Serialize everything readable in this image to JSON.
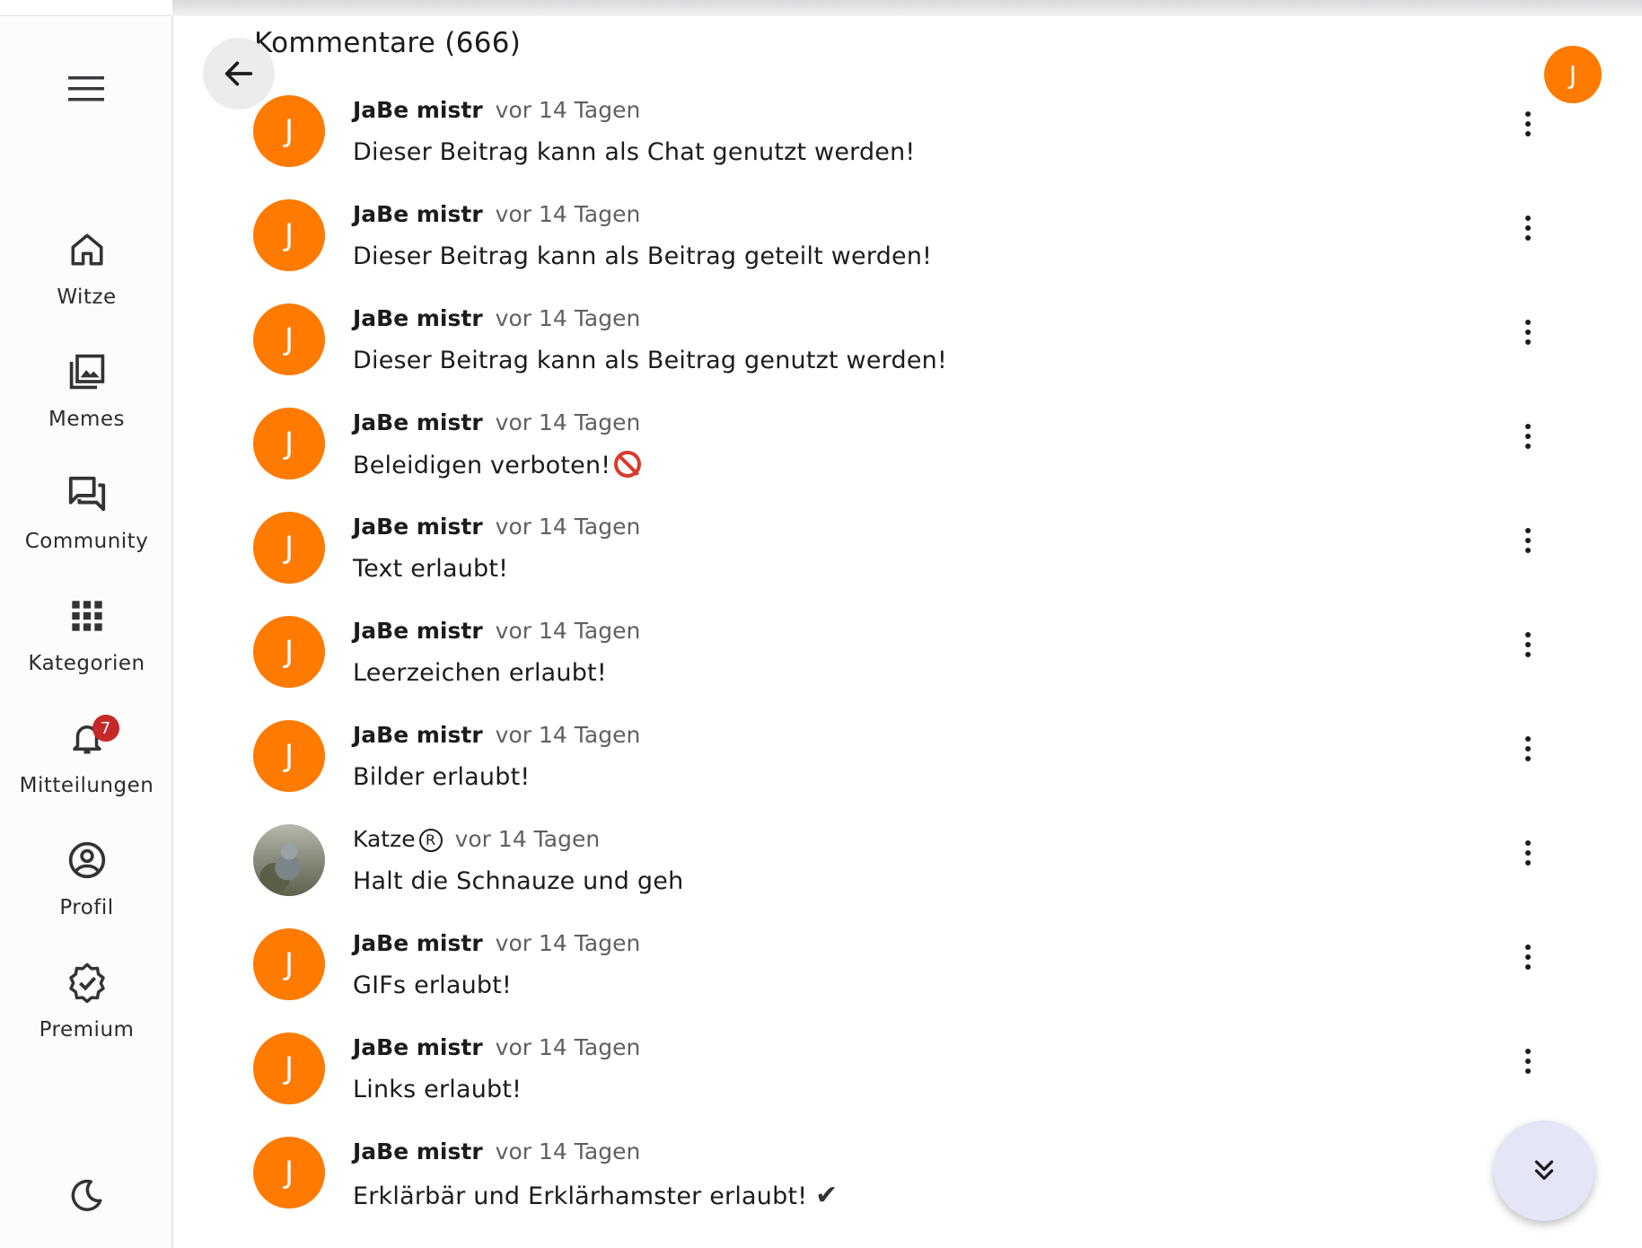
{
  "header": {
    "title": "Kommentare (666)",
    "user_initial": "J"
  },
  "sidebar": {
    "items": [
      {
        "label": "Witze",
        "icon": "home-icon"
      },
      {
        "label": "Memes",
        "icon": "photo-library-icon"
      },
      {
        "label": "Community",
        "icon": "forum-icon"
      },
      {
        "label": "Kategorien",
        "icon": "apps-grid-icon"
      },
      {
        "label": "Mitteilungen",
        "icon": "bell-icon",
        "badge": "7"
      },
      {
        "label": "Profil",
        "icon": "account-circle-icon"
      },
      {
        "label": "Premium",
        "icon": "verified-badge-icon"
      }
    ],
    "theme_toggle_icon": "moon-icon"
  },
  "comments": [
    {
      "author": "JaBe mistr",
      "initial": "J",
      "time": "vor 14 Tagen",
      "text": "Dieser Beitrag kann als Chat genutzt werden!"
    },
    {
      "author": "JaBe mistr",
      "initial": "J",
      "time": "vor 14 Tagen",
      "text": "Dieser Beitrag kann als Beitrag geteilt werden!"
    },
    {
      "author": "JaBe mistr",
      "initial": "J",
      "time": "vor 14 Tagen",
      "text": "Dieser Beitrag kann als Beitrag genutzt werden!"
    },
    {
      "author": "JaBe mistr",
      "initial": "J",
      "time": "vor 14 Tagen",
      "text": "Beleidigen verboten!"
    },
    {
      "author": "JaBe mistr",
      "initial": "J",
      "time": "vor 14 Tagen",
      "text": "Text erlaubt!"
    },
    {
      "author": "JaBe mistr",
      "initial": "J",
      "time": "vor 14 Tagen",
      "text": "Leerzeichen erlaubt!"
    },
    {
      "author": "JaBe mistr",
      "initial": "J",
      "time": "vor 14 Tagen",
      "text": "Bilder erlaubt!"
    },
    {
      "author": "Katze",
      "author_mark": "R",
      "time": "vor 14 Tagen",
      "text": "Halt die Schnauze und geh"
    },
    {
      "author": "JaBe mistr",
      "initial": "J",
      "time": "vor 14 Tagen",
      "text": "GIFs erlaubt!"
    },
    {
      "author": "JaBe mistr",
      "initial": "J",
      "time": "vor 14 Tagen",
      "text": "Links erlaubt!"
    },
    {
      "author": "JaBe mistr",
      "initial": "J",
      "time": "vor 14 Tagen",
      "text": "Erklärbär und Erklärhamster erlaubt!",
      "suffix": "✔"
    }
  ],
  "colors": {
    "avatar": "#ff7a00",
    "badge": "#c62828",
    "fab": "#e4e5f6"
  }
}
